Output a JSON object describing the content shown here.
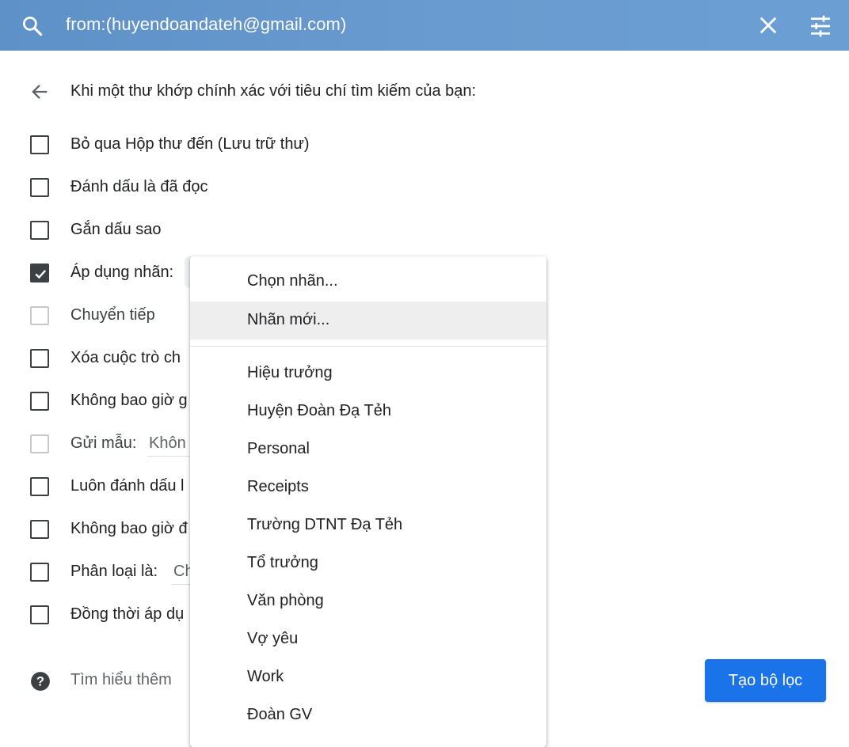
{
  "search": {
    "query": "from:(huyendoandateh@gmail.com)"
  },
  "filter": {
    "heading": "Khi một thư khớp chính xác với tiêu chí tìm kiếm của bạn:",
    "options": [
      {
        "label": "Bỏ qua Hộp thư đến (Lưu trữ thư)",
        "checked": false,
        "disabled": false
      },
      {
        "label": "Đánh dấu là đã đọc",
        "checked": false,
        "disabled": false
      },
      {
        "label": "Gắn dấu sao",
        "checked": false,
        "disabled": false
      },
      {
        "label": "Áp dụng nhãn:",
        "checked": true,
        "disabled": false
      },
      {
        "label": "Chuyển tiếp",
        "checked": false,
        "disabled": true
      },
      {
        "label": "Xóa cuộc trò ch",
        "checked": false,
        "disabled": false
      },
      {
        "label": "Không bao giờ g",
        "checked": false,
        "disabled": false
      },
      {
        "label": "Gửi mẫu:",
        "checked": false,
        "disabled": true,
        "select_value": "Khôn"
      },
      {
        "label": "Luôn đánh dấu l",
        "checked": false,
        "disabled": false
      },
      {
        "label": "Không bao giờ đ",
        "checked": false,
        "disabled": false
      },
      {
        "label": "Phân loại là:",
        "checked": false,
        "disabled": false,
        "select_value": "Ch"
      },
      {
        "label": "Đồng thời áp dụ",
        "checked": false,
        "disabled": false
      }
    ],
    "learn_more": "Tìm hiểu thêm",
    "create_button": "Tạo bộ lọc"
  },
  "label_menu": {
    "actions": [
      "Chọn nhãn...",
      "Nhãn mới..."
    ],
    "labels": [
      "Hiệu trưởng",
      "Huyện Đoàn Đạ Tẻh",
      "Personal",
      "Receipts",
      "Trường DTNT Đạ Tẻh",
      "Tổ trưởng",
      "Văn phòng",
      "Vợ yêu",
      "Work",
      "Đoàn GV"
    ]
  },
  "colors": {
    "topbar": "#6a9bd0",
    "primary": "#1a73e8",
    "menu_hover": "#eeeeee"
  },
  "icons": [
    "search-icon",
    "close-icon",
    "tune-icon",
    "back-arrow-icon",
    "help-icon",
    "check-icon"
  ]
}
